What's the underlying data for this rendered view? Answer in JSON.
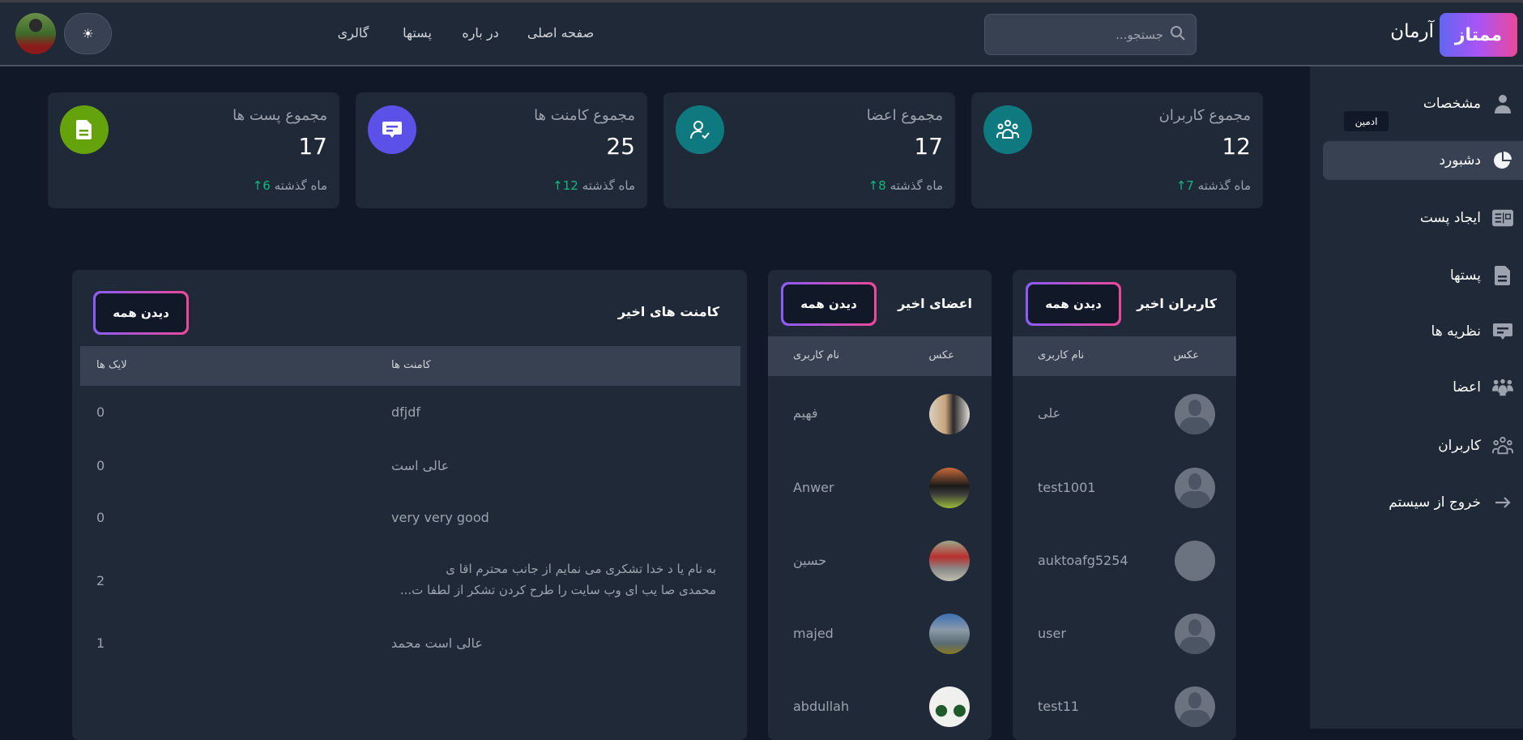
{
  "header": {
    "logo": "ممتاز",
    "brand": "آرمان",
    "search_placeholder": "جستجو...",
    "nav": [
      "صفحه اصلی",
      "در باره",
      "پستها",
      "گالری"
    ],
    "theme_icon": "☀"
  },
  "sidebar": {
    "badge": "ادمین",
    "items": [
      {
        "label": "مشخصات",
        "icon": "user-icon"
      },
      {
        "label": "دشبورد",
        "icon": "pie-chart-icon"
      },
      {
        "label": "ایجاد پست",
        "icon": "newspaper-icon"
      },
      {
        "label": "پستها",
        "icon": "document-icon"
      },
      {
        "label": "نظریه ها",
        "icon": "comment-icon"
      },
      {
        "label": "اعضا",
        "icon": "members-icon"
      },
      {
        "label": "کاربران",
        "icon": "users-icon"
      },
      {
        "label": "خروج از سیستم",
        "icon": "arrow-right-icon"
      }
    ]
  },
  "stats": [
    {
      "title": "مجموع کاربران",
      "value": "12",
      "delta": "7",
      "arrow": "↑",
      "foot": "ماه گذشته",
      "color": "#0e7a80"
    },
    {
      "title": "مجموع اعضا",
      "value": "17",
      "delta": "8",
      "arrow": "↑",
      "foot": "ماه گذشته",
      "color": "#0e7a80"
    },
    {
      "title": "مجموع کامنت ها",
      "value": "25",
      "delta": "12",
      "arrow": "↑",
      "foot": "ماه گذشته",
      "color": "#5b50e8"
    },
    {
      "title": "مجموع پست ها",
      "value": "17",
      "delta": "6",
      "arrow": "↑",
      "foot": "ماه گذشته",
      "color": "#65a30d"
    }
  ],
  "users_panel": {
    "title": "کاربران اخیر",
    "view_all": "دیدن همه",
    "col_photo": "عکس",
    "col_name": "نام کاربری",
    "rows": [
      "علی",
      "test1001",
      "auktoafg5254",
      "user",
      "test11"
    ]
  },
  "members_panel": {
    "title": "اعضای اخیر",
    "view_all": "دیدن همه",
    "col_photo": "عکس",
    "col_name": "نام کاربری",
    "rows": [
      "فهیم",
      "Anwer",
      "حسین",
      "majed",
      "abdullah"
    ]
  },
  "comments_panel": {
    "title": "کامنت های اخیر",
    "view_all": "دیدن همه",
    "col_comment": "کامنت ها",
    "col_likes": "لایک ها",
    "rows": [
      {
        "comment": "dfjdf",
        "likes": "0"
      },
      {
        "comment": "عالی است",
        "likes": "0"
      },
      {
        "comment": "very very good",
        "likes": "0"
      },
      {
        "comment": "به نام یا د خدا تشکری می نمایم از جانب محترم اقا ی",
        "comment2": "محمدی صا یب ای وب سایت را طرح کردن تشکر از لطفا ت...",
        "likes": "2"
      },
      {
        "comment": "عالی است محمد",
        "likes": "1"
      }
    ]
  }
}
